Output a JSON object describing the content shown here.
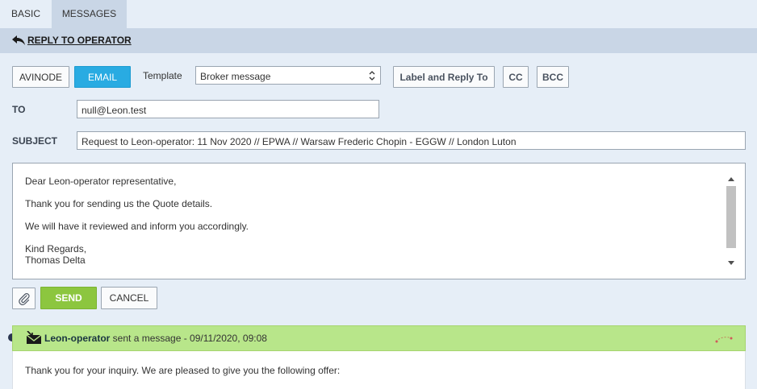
{
  "tabs": [
    {
      "label": "BASIC"
    },
    {
      "label": "MESSAGES"
    }
  ],
  "reply": {
    "link_label": "REPLY TO OPERATOR",
    "icon": "reply-arrow-icon"
  },
  "toolbar": {
    "avinode_label": "AVINODE",
    "email_label": "EMAIL",
    "template_label": "Template",
    "template_value": "Broker message",
    "label_reply_label": "Label and Reply To",
    "cc_label": "CC",
    "bcc_label": "BCC"
  },
  "form": {
    "to_label": "TO",
    "to_value": "null@Leon.test",
    "subject_label": "SUBJECT",
    "subject_value": "Request to Leon-operator: 11 Nov 2020 // EPWA // Warsaw Frederic Chopin - EGGW // London Luton"
  },
  "body": {
    "lines": [
      "Dear Leon-operator representative,",
      "Thank you for sending us the Quote details.",
      "We will have it reviewed and inform you accordingly.",
      "Kind Regards,",
      "Thomas Delta"
    ]
  },
  "actions": {
    "send_label": "SEND",
    "cancel_label": "CANCEL"
  },
  "message": {
    "sender": "Leon-operator",
    "action_text": " sent a message - 09/11/2020, 09:08",
    "body_text": "Thank you for your inquiry. We are pleased to give you the following offer:"
  },
  "colors": {
    "email_active": "#29abe2",
    "send_green": "#8cc63f",
    "message_header_green": "#b8e68a",
    "panel_bg": "#e6eef7"
  }
}
